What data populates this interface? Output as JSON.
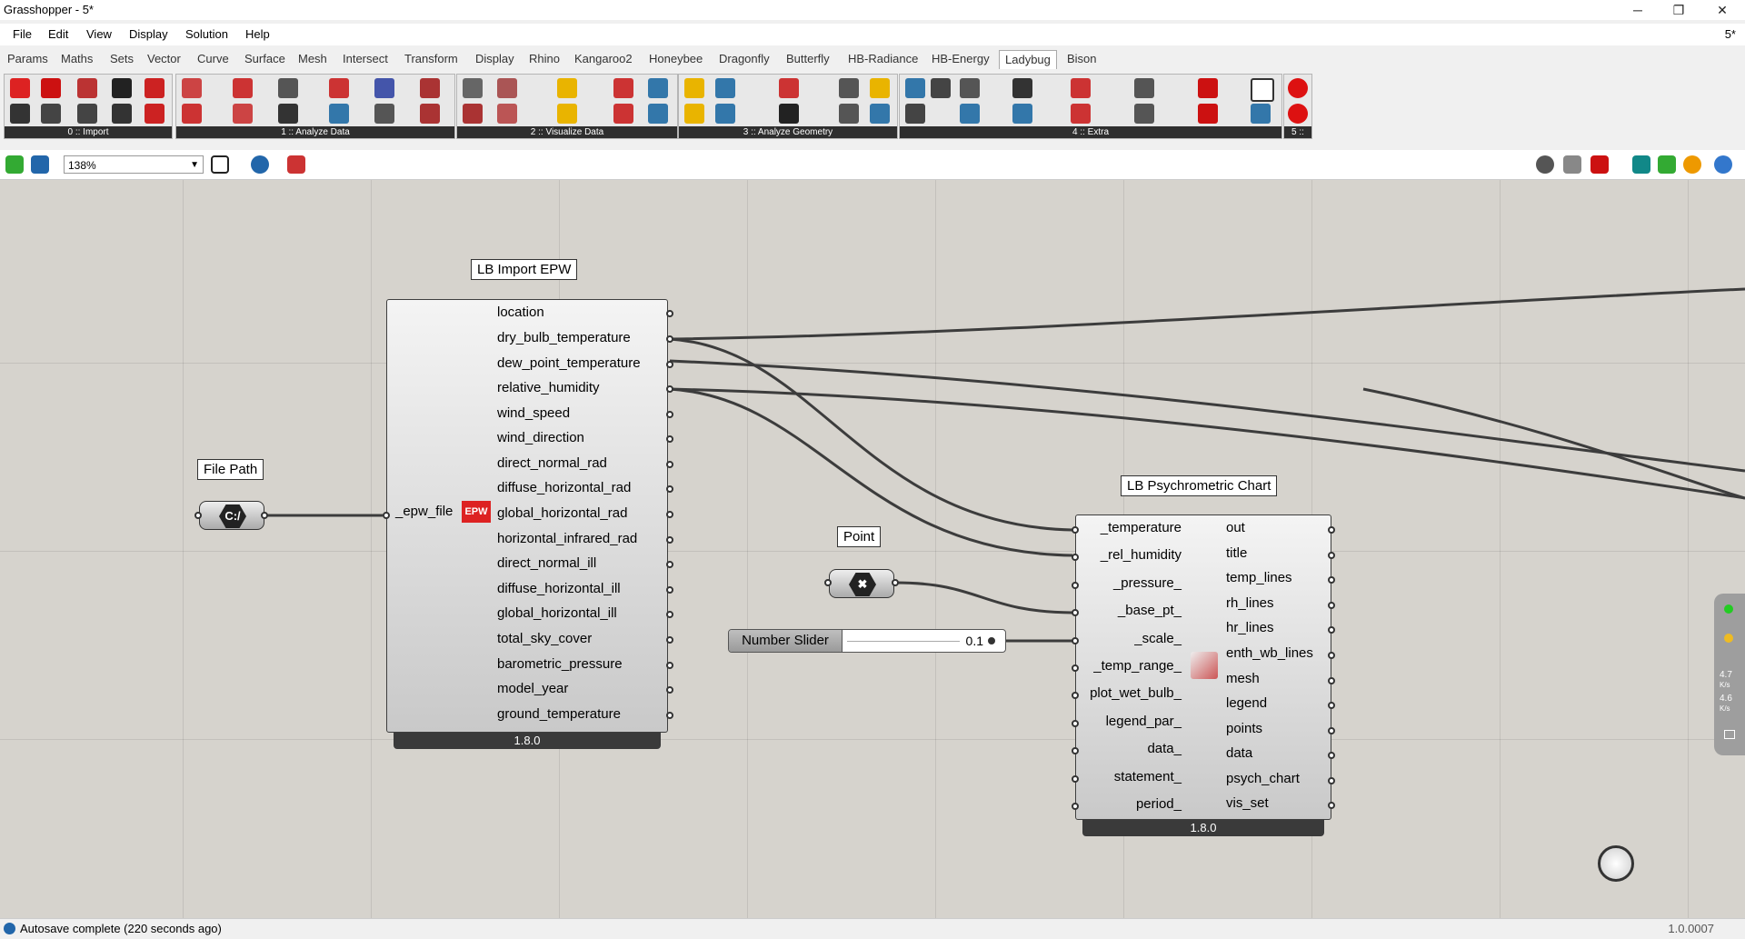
{
  "window": {
    "title": "Grasshopper - 5*",
    "minimize": "─",
    "maximize": "❐",
    "close": "✕"
  },
  "menu": {
    "items": [
      "File",
      "Edit",
      "View",
      "Display",
      "Solution",
      "Help"
    ],
    "doc_label": "5*"
  },
  "tabs": [
    "Params",
    "Maths",
    "Sets",
    "Vector",
    "Curve",
    "Surface",
    "Mesh",
    "Intersect",
    "Transform",
    "Display",
    "Rhino",
    "Kangaroo2",
    "Honeybee",
    "Dragonfly",
    "Butterfly",
    "HB-Radiance",
    "HB-Energy",
    "Ladybug",
    "Bison"
  ],
  "active_tab": "Ladybug",
  "ribbon_groups": [
    "0 :: Import",
    "1 :: Analyze Data",
    "2 :: Visualize Data",
    "3 :: Analyze Geometry",
    "4 :: Extra",
    "5 ::"
  ],
  "toolbar": {
    "zoom": "138%"
  },
  "components": {
    "import_epw": {
      "name": "LB Import EPW",
      "inputs": [
        "_epw_file"
      ],
      "outputs": [
        "location",
        "dry_bulb_temperature",
        "dew_point_temperature",
        "relative_humidity",
        "wind_speed",
        "wind_direction",
        "direct_normal_rad",
        "diffuse_horizontal_rad",
        "global_horizontal_rad",
        "horizontal_infrared_rad",
        "direct_normal_ill",
        "diffuse_horizontal_ill",
        "global_horizontal_ill",
        "total_sky_cover",
        "barometric_pressure",
        "model_year",
        "ground_temperature"
      ],
      "version": "1.8.0",
      "icon_text": "EPW"
    },
    "file_path": {
      "name": "File Path",
      "icon_text": "C:/"
    },
    "point": {
      "name": "Point",
      "icon_text": "✖"
    },
    "slider": {
      "name": "Number Slider",
      "value": "0.1"
    },
    "psych_chart": {
      "name": "LB Psychrometric Chart",
      "inputs": [
        "_temperature",
        "_rel_humidity",
        "_pressure_",
        "_base_pt_",
        "_scale_",
        "_temp_range_",
        "plot_wet_bulb_",
        "legend_par_",
        "data_",
        "statement_",
        "period_"
      ],
      "outputs": [
        "out",
        "title",
        "temp_lines",
        "rh_lines",
        "hr_lines",
        "enth_wb_lines",
        "mesh",
        "legend",
        "points",
        "data",
        "psych_chart",
        "vis_set"
      ],
      "version": "1.8.0"
    }
  },
  "right_panel": {
    "stat1": "4.7",
    "stat1_unit": "K/s",
    "stat2": "4.6",
    "stat2_unit": "K/s"
  },
  "status": {
    "message": "Autosave complete (220 seconds ago)",
    "version": "1.0.0007"
  }
}
